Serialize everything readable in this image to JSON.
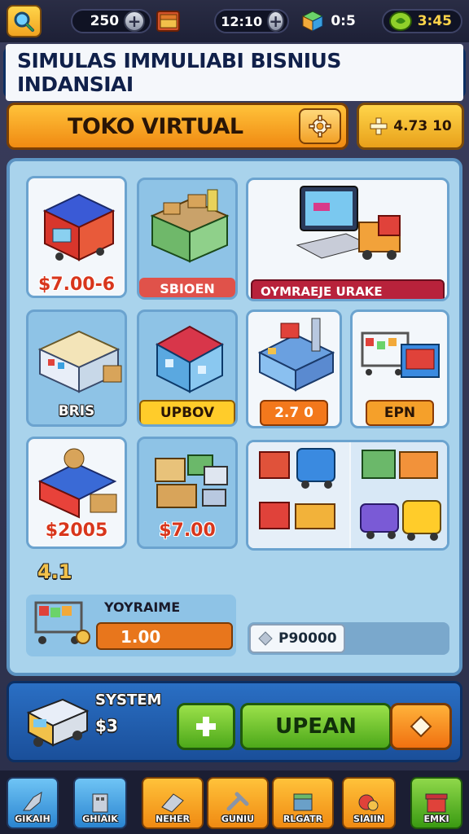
{
  "topbar": {
    "stats": [
      {
        "value": "250",
        "icon": "gem-icon"
      },
      {
        "value": "12:10",
        "icon": "chest-icon"
      },
      {
        "value": "0:5",
        "icon": "cube-icon"
      },
      {
        "value": "3:45",
        "icon": "leaf-coin-icon"
      }
    ]
  },
  "title": "SIMULAS IMMULIABI BISNIUS INDANSIAI",
  "subheader": {
    "title": "TOKO VIRTUAL",
    "coin_value": "4.73 10"
  },
  "cards": {
    "c1": {
      "price": "$7.00-6"
    },
    "c2": {
      "label": "SBIOEN"
    },
    "c3": {
      "label": "OYMRAEJE URAKE"
    },
    "c4": {
      "label": "BRIS"
    },
    "c5": {
      "label": "UPBOV"
    },
    "c6": {
      "label": "2.7 0"
    },
    "c7": {
      "label": "EPN"
    },
    "c8": {
      "price": "$2005"
    },
    "c9": {
      "price": "$7.00"
    }
  },
  "lower": {
    "small_number": "4.1",
    "cart_title": "YOYRAIME",
    "cart_value": "1.00",
    "right_value": "P90000"
  },
  "system": {
    "title": "SYSTEM",
    "value": "$3",
    "upgrade_label": "UPEAN"
  },
  "nav": [
    {
      "label": "GIKAIH"
    },
    {
      "label": "GHIAIK"
    },
    {
      "label": "NEHER"
    },
    {
      "label": "GUNIU"
    },
    {
      "label": "RLGATR"
    },
    {
      "label": "SIAIIN"
    },
    {
      "label": "EMKI"
    }
  ],
  "colors": {
    "accent_orange": "#f08a12",
    "accent_blue": "#1a56a8",
    "panel_bg": "#a9d3ec",
    "price_red": "#d8361c",
    "green": "#4da81a"
  }
}
